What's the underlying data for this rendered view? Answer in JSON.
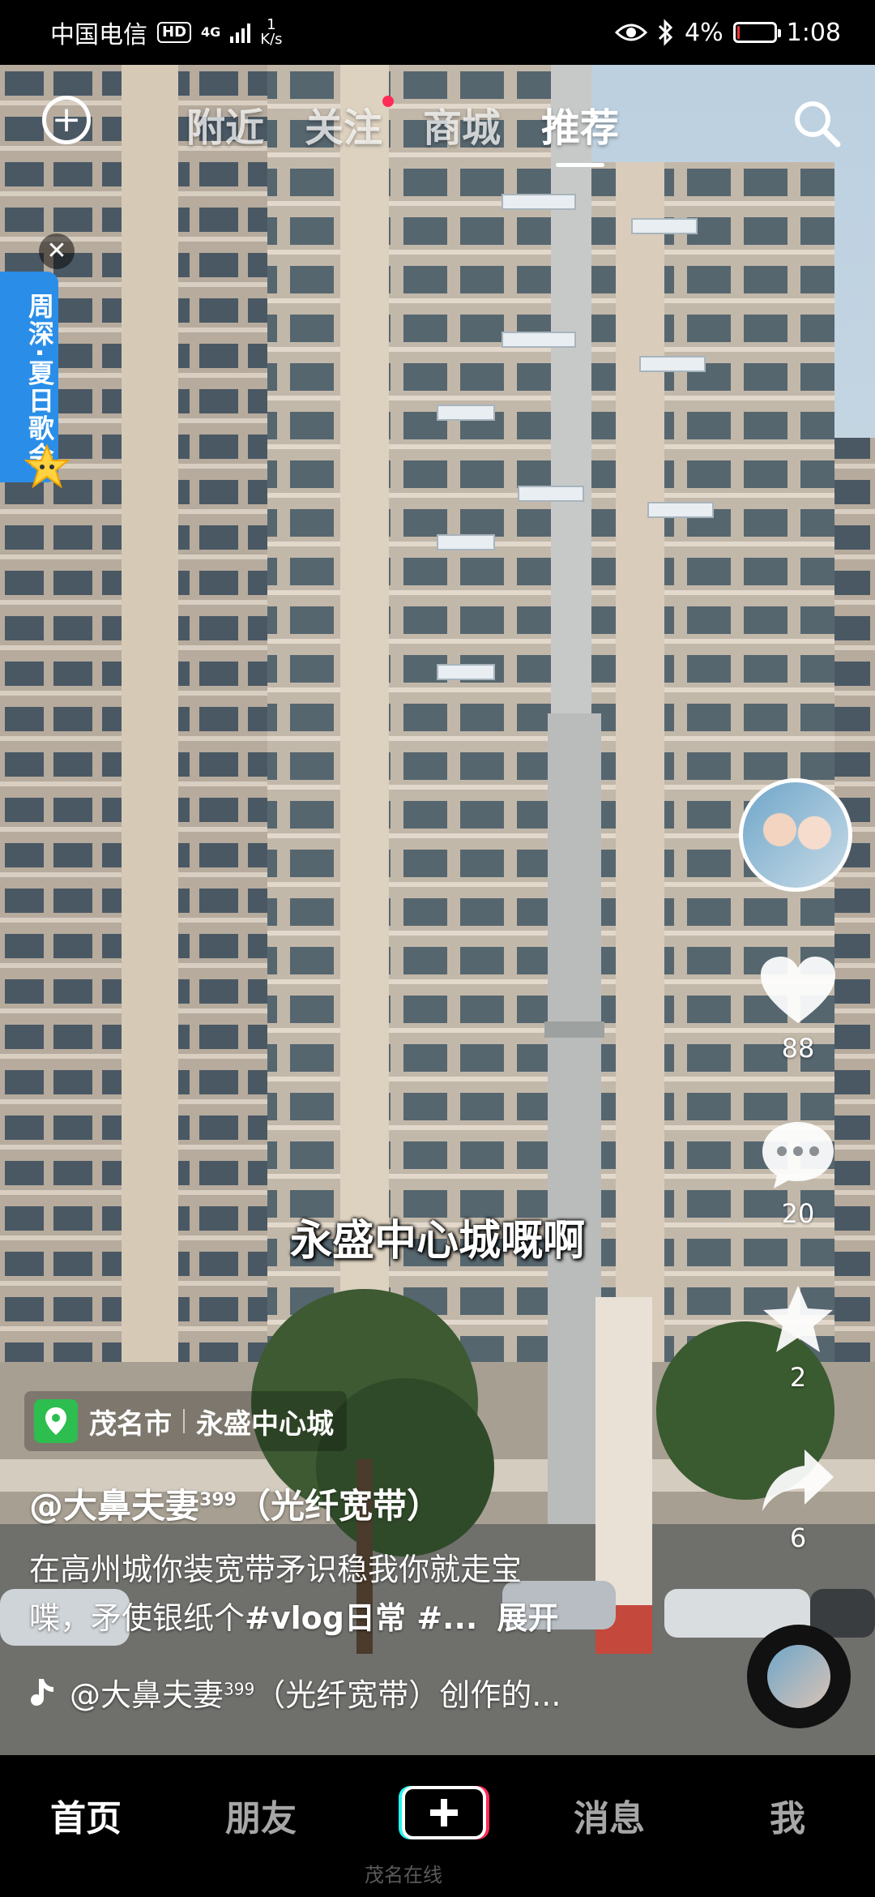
{
  "status_bar": {
    "carrier": "中国电信",
    "hd": "HD",
    "network": "4G",
    "speed_value": "1",
    "speed_unit": "K/s",
    "battery": "4%",
    "time": "1:08"
  },
  "top_nav": {
    "tabs": [
      {
        "label": "附近",
        "active": false
      },
      {
        "label": "关注",
        "active": false,
        "red_dot": true
      },
      {
        "label": "商城",
        "active": false
      },
      {
        "label": "推荐",
        "active": true
      }
    ]
  },
  "side_banner": {
    "text": "周深·夏日歌会"
  },
  "actions": {
    "likes": "88",
    "comments": "20",
    "favorites": "2",
    "shares": "6"
  },
  "video": {
    "subtitle": "永盛中心城嘅啊"
  },
  "location": {
    "city": "茂名市",
    "place": "永盛中心城"
  },
  "author": {
    "name": "@大鼻夫妻",
    "sup": "399",
    "tag": "（光纤宽带）"
  },
  "description": {
    "line1": "在高州城你装宽带矛识稳我你就走宝",
    "line2_prefix": "喋，矛使银纸个",
    "hashtags": "#vlog日常 #...",
    "expand": "展开"
  },
  "music": {
    "name": "@大鼻夫妻",
    "sup": "399",
    "rest": "（光纤宽带）创作的..."
  },
  "bottom_nav": {
    "home": "首页",
    "friends": "朋友",
    "messages": "消息",
    "me": "我",
    "watermark": "茂名在线"
  },
  "colors": {
    "accent_red": "#ff2d55",
    "location_green": "#2dbe4f",
    "banner_blue": "#2a8ee8"
  }
}
